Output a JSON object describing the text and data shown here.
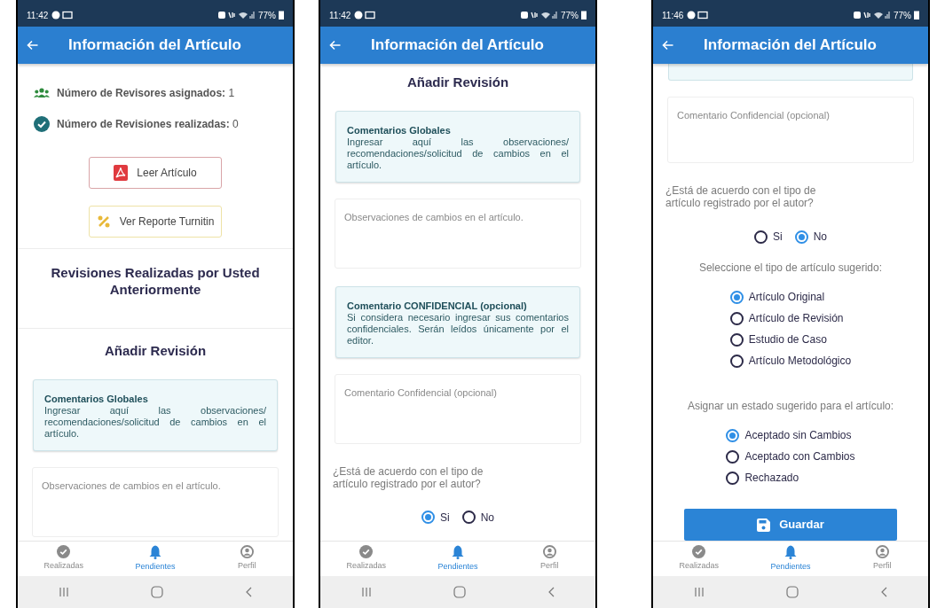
{
  "phones": [
    {
      "status_bar": {
        "time": "11:42",
        "battery": "77%"
      },
      "app_bar": {
        "title": "Información del Artículo"
      },
      "content": [
        {
          "kind": "reviewers",
          "label": "Número de Revisores asignados:",
          "value": "1"
        },
        {
          "kind": "reviews",
          "label": "Número de Revisiones realizadas:",
          "value": "0"
        },
        {
          "kind": "pdf_button",
          "label": "Leer Artículo"
        },
        {
          "kind": "report_button",
          "label": "Ver Reporte Turnitin"
        },
        {
          "kind": "divider"
        },
        {
          "kind": "heading",
          "text": "Revisiones Realizadas por Usted Anteriormente"
        },
        {
          "kind": "divider"
        },
        {
          "kind": "title",
          "text": "Añadir Revisión"
        },
        {
          "kind": "note",
          "title": "Comentarios Globales",
          "body": "Ingresar aquí las observaciones/ recomendaciones/solicitud de cambios en el artículo."
        },
        {
          "kind": "textarea",
          "placeholder": "Observaciones de cambios en el artículo."
        }
      ],
      "tabs": [
        {
          "kind": "done",
          "label": "Realizadas",
          "selected": false
        },
        {
          "kind": "pending",
          "label": "Pendientes",
          "selected": true
        },
        {
          "kind": "profile",
          "label": "Perfil",
          "selected": false
        }
      ]
    },
    {
      "status_bar": {
        "time": "11:42",
        "battery": "77%"
      },
      "app_bar": {
        "title": "Información del Artículo"
      },
      "content": [
        {
          "kind": "title",
          "text": "Añadir Revisión"
        },
        {
          "kind": "note",
          "title": "Comentarios Globales",
          "body": "Ingresar aquí las observaciones/ recomendaciones/solicitud de cambios en el artículo."
        },
        {
          "kind": "textarea",
          "placeholder": "Observaciones de cambios en el artículo."
        },
        {
          "kind": "note",
          "title": "Comentario CONFIDENCIAL (opcional)",
          "body": "Si considera necesario ingresar sus comentarios confidenciales. Serán leídos únicamente por el editor."
        },
        {
          "kind": "textarea",
          "placeholder": "Comentario Confidencial (opcional)"
        },
        {
          "kind": "question",
          "text": "¿Está de acuerdo con el tipo de artículo registrado por el autor?"
        },
        {
          "kind": "radio_inline",
          "options": [
            {
              "label": "Si",
              "selected": true
            },
            {
              "label": "No",
              "selected": false
            }
          ]
        }
      ],
      "tabs": [
        {
          "kind": "done",
          "label": "Realizadas",
          "selected": false
        },
        {
          "kind": "pending",
          "label": "Pendientes",
          "selected": true
        },
        {
          "kind": "profile",
          "label": "Perfil",
          "selected": false
        }
      ]
    },
    {
      "status_bar": {
        "time": "11:46",
        "battery": "77%"
      },
      "app_bar": {
        "title": "Información del Artículo"
      },
      "content": [
        {
          "kind": "note_tail"
        },
        {
          "kind": "textarea",
          "placeholder": "Comentario Confidencial (opcional)"
        },
        {
          "kind": "question",
          "text": "¿Está de acuerdo con el tipo de artículo registrado por el autor?"
        },
        {
          "kind": "radio_inline",
          "options": [
            {
              "label": "Si",
              "selected": false
            },
            {
              "label": "No",
              "selected": true
            }
          ]
        },
        {
          "kind": "prompt",
          "text": "Seleccione el tipo de artículo sugerido:"
        },
        {
          "kind": "radio_list",
          "options": [
            {
              "label": "Artículo Original",
              "selected": true
            },
            {
              "label": "Artículo de Revisión",
              "selected": false
            },
            {
              "label": "Estudio de Caso",
              "selected": false
            },
            {
              "label": "Artículo Metodológico",
              "selected": false
            }
          ]
        },
        {
          "kind": "prompt",
          "text": "Asignar un estado sugerido para el artículo:"
        },
        {
          "kind": "radio_list",
          "options": [
            {
              "label": "Aceptado sin Cambios",
              "selected": true
            },
            {
              "label": "Aceptado con Cambios",
              "selected": false
            },
            {
              "label": "Rechazado",
              "selected": false
            }
          ]
        },
        {
          "kind": "save_button",
          "label": "Guardar"
        }
      ],
      "tabs": [
        {
          "kind": "done",
          "label": "Realizadas",
          "selected": false
        },
        {
          "kind": "pending",
          "label": "Pendientes",
          "selected": true
        },
        {
          "kind": "profile",
          "label": "Perfil",
          "selected": false
        }
      ]
    }
  ]
}
